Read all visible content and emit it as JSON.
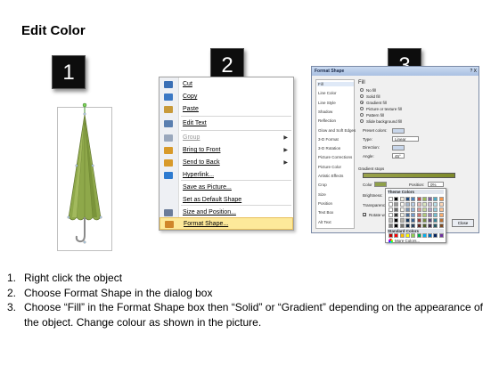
{
  "title": "Edit Color",
  "badges": [
    "1",
    "2",
    "3"
  ],
  "context_menu": {
    "items": [
      {
        "label": "Cut",
        "icon": "scissors-icon",
        "color": "#3a6fb5",
        "arrow": false,
        "disabled": false
      },
      {
        "label": "Copy",
        "icon": "copy-icon",
        "color": "#3b78c4",
        "arrow": false,
        "disabled": false
      },
      {
        "label": "Paste",
        "icon": "paste-icon",
        "color": "#c89a3a",
        "arrow": false,
        "disabled": false
      },
      {
        "label": "Edit Text",
        "icon": "edit-text-icon",
        "color": "#5a7fb0",
        "arrow": false,
        "disabled": false
      },
      {
        "label": "Group",
        "icon": "group-icon",
        "color": "#9aa8bd",
        "arrow": true,
        "disabled": true
      },
      {
        "label": "Bring to Front",
        "icon": "bring-to-front-icon",
        "color": "#d89a2a",
        "arrow": true,
        "disabled": false
      },
      {
        "label": "Send to Back",
        "icon": "send-to-back-icon",
        "color": "#d89a2a",
        "arrow": true,
        "disabled": false
      },
      {
        "label": "Hyperlink...",
        "icon": "hyperlink-icon",
        "color": "#2e7bd0",
        "arrow": false,
        "disabled": false
      },
      {
        "label": "Save as Picture...",
        "icon": "",
        "color": "",
        "arrow": false,
        "disabled": false
      },
      {
        "label": "Set as Default Shape",
        "icon": "",
        "color": "",
        "arrow": false,
        "disabled": false
      },
      {
        "label": "Size and Position...",
        "icon": "size-position-icon",
        "color": "#6a7c99",
        "arrow": false,
        "disabled": false
      },
      {
        "label": "Format Shape...",
        "icon": "format-shape-icon",
        "color": "#d0862a",
        "arrow": false,
        "disabled": false,
        "active": true
      }
    ]
  },
  "dialog": {
    "title": "Format Shape",
    "window_buttons": "? X",
    "nav": [
      "Fill",
      "Line Color",
      "Line Style",
      "Shadow",
      "Reflection",
      "Glow and Soft Edges",
      "3-D Format",
      "3-D Rotation",
      "Picture Corrections",
      "Picture Color",
      "Artistic Effects",
      "Crop",
      "Size",
      "Position",
      "Text Box",
      "Alt Text"
    ],
    "fill_heading": "Fill",
    "fill_options": [
      {
        "label": "No fill",
        "checked": false
      },
      {
        "label": "Solid fill",
        "checked": false
      },
      {
        "label": "Gradient fill",
        "checked": true
      },
      {
        "label": "Picture or texture fill",
        "checked": false
      },
      {
        "label": "Pattern fill",
        "checked": false
      },
      {
        "label": "Slide background fill",
        "checked": false
      }
    ],
    "fields": [
      {
        "label": "Preset colors:",
        "value": ""
      },
      {
        "label": "Type:",
        "value": "Linear"
      },
      {
        "label": "Direction:",
        "value": ""
      },
      {
        "label": "Angle:",
        "value": "45°"
      }
    ],
    "gradient_stops_label": "Gradient stops",
    "color_label": "Color",
    "position_label": "Position:",
    "position_value": "0%",
    "brightness_label": "Brightness:",
    "transparency_label": "Transparency:",
    "rotate_label": "Rotate with shape",
    "close_label": "Close",
    "popup": {
      "theme_label": "Theme Colors",
      "standard_label": "Standard Colors",
      "more_label": "More Colors...",
      "theme_top": [
        "#ffffff",
        "#000000",
        "#eeece1",
        "#1f497d",
        "#4f81bd",
        "#c0504d",
        "#9bbb59",
        "#8064a2",
        "#4bacc6",
        "#f79646"
      ],
      "standard": [
        "#c00000",
        "#ff0000",
        "#ffc000",
        "#ffff00",
        "#92d050",
        "#00b050",
        "#00b0f0",
        "#0070c0",
        "#002060",
        "#7030a0"
      ]
    }
  },
  "instructions": [
    {
      "num": "1.",
      "text": "Right click the object"
    },
    {
      "num": "2.",
      "text": "Choose Format Shape in the dialog box"
    },
    {
      "num": "3.",
      "text": "Choose “Fill” in the Format Shape box then “Solid” or “Gradient” depending on the appearance of the object. Change colour as shown in the picture."
    }
  ]
}
